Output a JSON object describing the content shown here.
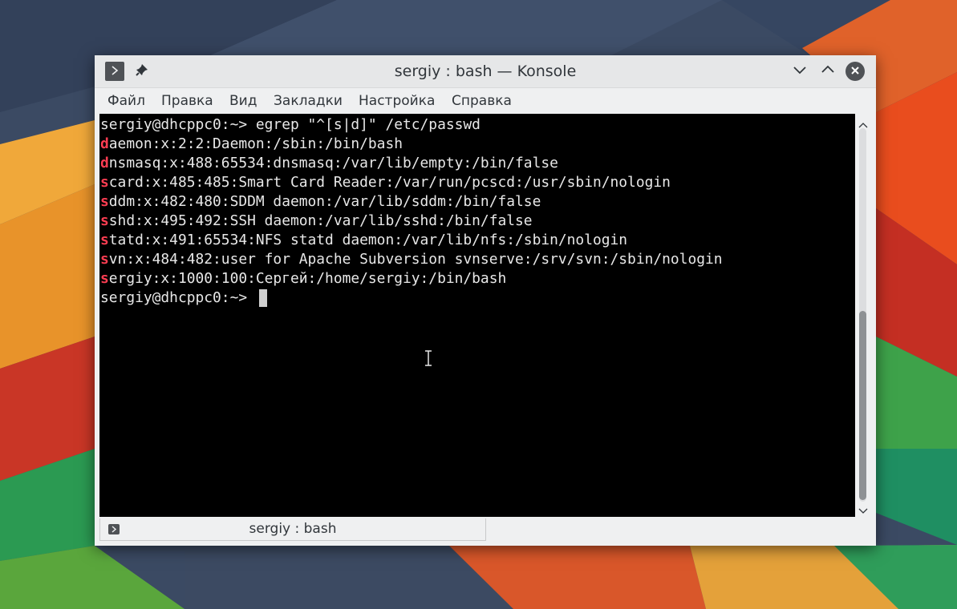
{
  "window": {
    "title": "sergiy : bash — Konsole"
  },
  "menubar": [
    "Файл",
    "Правка",
    "Вид",
    "Закладки",
    "Настройка",
    "Справка"
  ],
  "terminal": {
    "lines": [
      {
        "hl": "",
        "rest": "sergiy@dhcppc0:~> egrep \"^[s|d]\" /etc/passwd"
      },
      {
        "hl": "d",
        "rest": "aemon:x:2:2:Daemon:/sbin:/bin/bash"
      },
      {
        "hl": "d",
        "rest": "nsmasq:x:488:65534:dnsmasq:/var/lib/empty:/bin/false"
      },
      {
        "hl": "s",
        "rest": "card:x:485:485:Smart Card Reader:/var/run/pcscd:/usr/sbin/nologin"
      },
      {
        "hl": "s",
        "rest": "ddm:x:482:480:SDDM daemon:/var/lib/sddm:/bin/false"
      },
      {
        "hl": "s",
        "rest": "shd:x:495:492:SSH daemon:/var/lib/sshd:/bin/false"
      },
      {
        "hl": "s",
        "rest": "tatd:x:491:65534:NFS statd daemon:/var/lib/nfs:/sbin/nologin"
      },
      {
        "hl": "s",
        "rest": "vn:x:484:482:user for Apache Subversion svnserve:/srv/svn:/sbin/nologin"
      },
      {
        "hl": "s",
        "rest": "ergiy:x:1000:100:Сергей:/home/sergiy:/bin/bash"
      },
      {
        "hl": "",
        "rest": "sergiy@dhcppc0:~> "
      }
    ]
  },
  "tab": {
    "label": "sergiy : bash"
  },
  "icons": {
    "menu": "terminal-prompt-icon",
    "pin": "pin-icon",
    "minimize": "chevron-down-icon",
    "maximize": "chevron-up-icon",
    "close": "close-icon",
    "cursor": "text-ibeam-icon"
  },
  "colors": {
    "highlight": "#ff3d52",
    "terminal_bg": "#000000",
    "terminal_fg": "#e8e8e8"
  }
}
